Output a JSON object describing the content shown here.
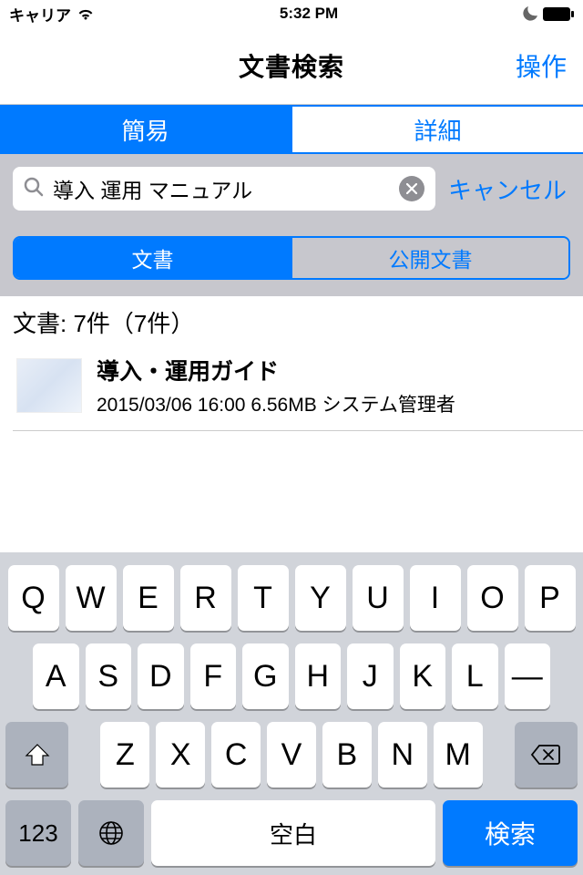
{
  "statusBar": {
    "carrier": "キャリア",
    "time": "5:32 PM"
  },
  "nav": {
    "title": "文書検索",
    "action": "操作"
  },
  "modeTabs": {
    "simple": "簡易",
    "detail": "詳細"
  },
  "search": {
    "query": "導入 運用 マニュアル",
    "cancel": "キャンセル"
  },
  "scopeTabs": {
    "doc": "文書",
    "publicDoc": "公開文書"
  },
  "results": {
    "header": "文書: 7件（7件）",
    "items": [
      {
        "title": "導入・運用ガイド",
        "meta": "2015/03/06 16:00 6.56MB システム管理者"
      }
    ]
  },
  "keyboard": {
    "row1": [
      "Q",
      "W",
      "E",
      "R",
      "T",
      "Y",
      "U",
      "I",
      "O",
      "P"
    ],
    "row2": [
      "A",
      "S",
      "D",
      "F",
      "G",
      "H",
      "J",
      "K",
      "L",
      "—"
    ],
    "row3": [
      "Z",
      "X",
      "C",
      "V",
      "B",
      "N",
      "M"
    ],
    "numKey": "123",
    "space": "空白",
    "return": "検索"
  }
}
